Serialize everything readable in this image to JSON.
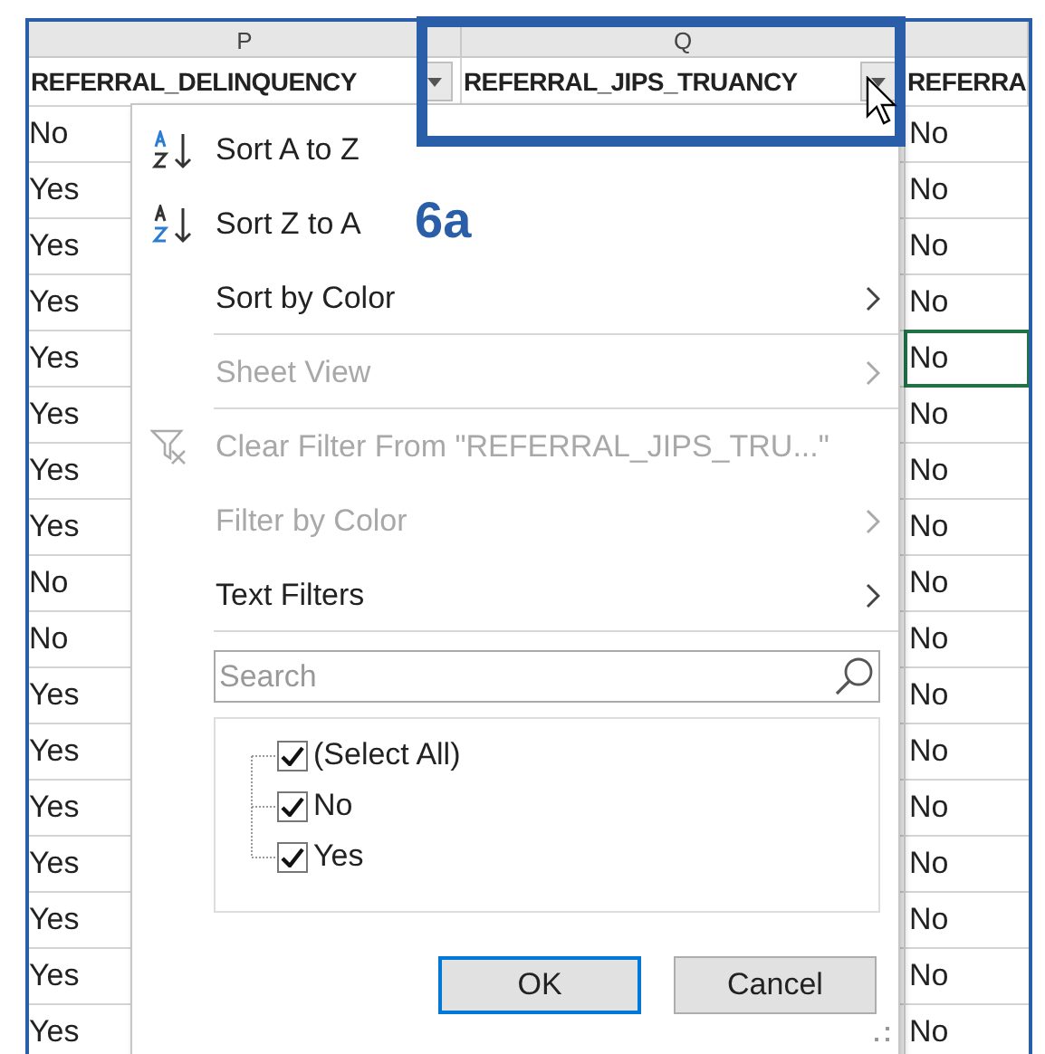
{
  "columns": [
    {
      "letter": "P",
      "header": "REFERRAL_DELINQUENCY",
      "filter_button": true
    },
    {
      "letter": "Q",
      "header": "REFERRAL_JIPS_TRUANCY",
      "filter_button": true
    },
    {
      "header": "REFERRA",
      "filter_button": false
    }
  ],
  "rows": [
    {
      "p": "No",
      "r": "No",
      "r_selected": false
    },
    {
      "p": "Yes",
      "r": "No",
      "r_selected": false
    },
    {
      "p": "Yes",
      "r": "No",
      "r_selected": false
    },
    {
      "p": "Yes",
      "r": "No",
      "r_selected": false
    },
    {
      "p": "Yes",
      "r": "No",
      "r_selected": true
    },
    {
      "p": "Yes",
      "r": "No",
      "r_selected": false
    },
    {
      "p": "Yes",
      "r": "No",
      "r_selected": false
    },
    {
      "p": "Yes",
      "r": "No",
      "r_selected": false
    },
    {
      "p": "No",
      "r": "No",
      "r_selected": false
    },
    {
      "p": "No",
      "r": "No",
      "r_selected": false
    },
    {
      "p": "Yes",
      "r": "No",
      "r_selected": false
    },
    {
      "p": "Yes",
      "r": "No",
      "r_selected": false
    },
    {
      "p": "Yes",
      "r": "No",
      "r_selected": false
    },
    {
      "p": "Yes",
      "r": "No",
      "r_selected": false
    },
    {
      "p": "Yes",
      "r": "No",
      "r_selected": false
    },
    {
      "p": "Yes",
      "r": "No",
      "r_selected": false
    },
    {
      "p": "Yes",
      "r": "No",
      "r_selected": false
    }
  ],
  "filter_menu": {
    "items": [
      {
        "kind": "sort_az",
        "label": "Sort A to Z",
        "disabled": false,
        "submenu": false,
        "separator_after": false
      },
      {
        "kind": "sort_za",
        "label": "Sort Z to A",
        "disabled": false,
        "submenu": false,
        "separator_after": false
      },
      {
        "kind": "plain",
        "label": "Sort by Color",
        "disabled": false,
        "submenu": true,
        "separator_after": true
      },
      {
        "kind": "plain",
        "label": "Sheet View",
        "disabled": true,
        "submenu": true,
        "separator_after": true
      },
      {
        "kind": "clear",
        "label": "Clear Filter From \"REFERRAL_JIPS_TRU...\"",
        "disabled": true,
        "submenu": false,
        "separator_after": false
      },
      {
        "kind": "plain",
        "label": "Filter by Color",
        "disabled": true,
        "submenu": true,
        "separator_after": false
      },
      {
        "kind": "plain",
        "label": "Text Filters",
        "disabled": false,
        "submenu": true,
        "separator_after": true
      }
    ],
    "search": {
      "placeholder": "Search"
    },
    "values": [
      {
        "label": "(Select All)",
        "checked": true
      },
      {
        "label": "No",
        "checked": true
      },
      {
        "label": "Yes",
        "checked": true
      }
    ],
    "buttons": [
      {
        "label": "OK",
        "default": true
      },
      {
        "label": "Cancel",
        "default": false
      }
    ]
  },
  "callout": {
    "label": "6a"
  }
}
